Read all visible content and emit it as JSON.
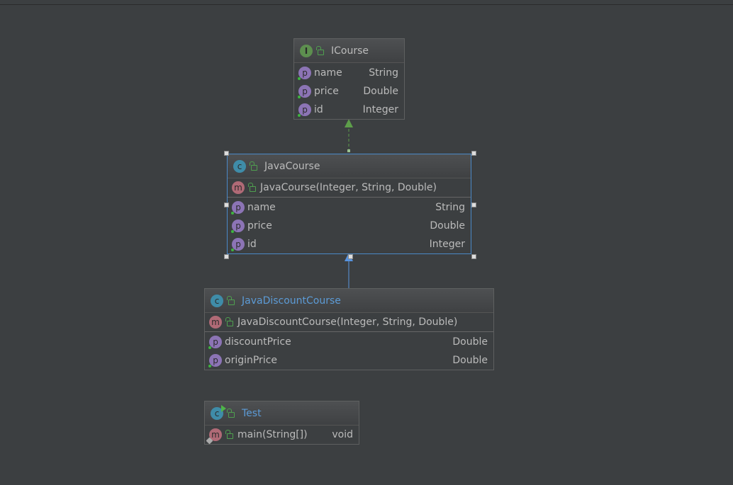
{
  "classes": [
    {
      "id": "icourse",
      "kind": "interface",
      "icon": "I",
      "title": "ICourse",
      "title_color": "default",
      "methods": [],
      "fields": [
        {
          "name": "name",
          "type": "String"
        },
        {
          "name": "price",
          "type": "Double"
        },
        {
          "name": "id",
          "type": "Integer"
        }
      ]
    },
    {
      "id": "javacourse",
      "kind": "class",
      "icon": "c",
      "title": "JavaCourse",
      "title_color": "default",
      "selected": true,
      "methods": [
        {
          "name": "JavaCourse(Integer, String, Double)",
          "type": ""
        }
      ],
      "fields": [
        {
          "name": "name",
          "type": "String"
        },
        {
          "name": "price",
          "type": "Double"
        },
        {
          "name": "id",
          "type": "Integer"
        }
      ]
    },
    {
      "id": "javadiscountcourse",
      "kind": "class",
      "icon": "c",
      "title": "JavaDiscountCourse",
      "title_color": "#5c9bd6",
      "methods": [
        {
          "name": "JavaDiscountCourse(Integer, String, Double)",
          "type": ""
        }
      ],
      "fields": [
        {
          "name": "discountPrice",
          "type": "Double"
        },
        {
          "name": "originPrice",
          "type": "Double"
        }
      ]
    },
    {
      "id": "test",
      "kind": "runnable-class",
      "icon": "c",
      "title": "Test",
      "title_color": "#5c9bd6",
      "methods": [
        {
          "name": "main(String[])",
          "type": "void",
          "static": true
        }
      ],
      "fields": []
    }
  ],
  "relations": [
    {
      "from": "JavaCourse",
      "to": "ICourse",
      "type": "implements",
      "color": "#5d9e4a"
    },
    {
      "from": "JavaDiscountCourse",
      "to": "JavaCourse",
      "type": "extends",
      "color": "#5894e0"
    }
  ]
}
